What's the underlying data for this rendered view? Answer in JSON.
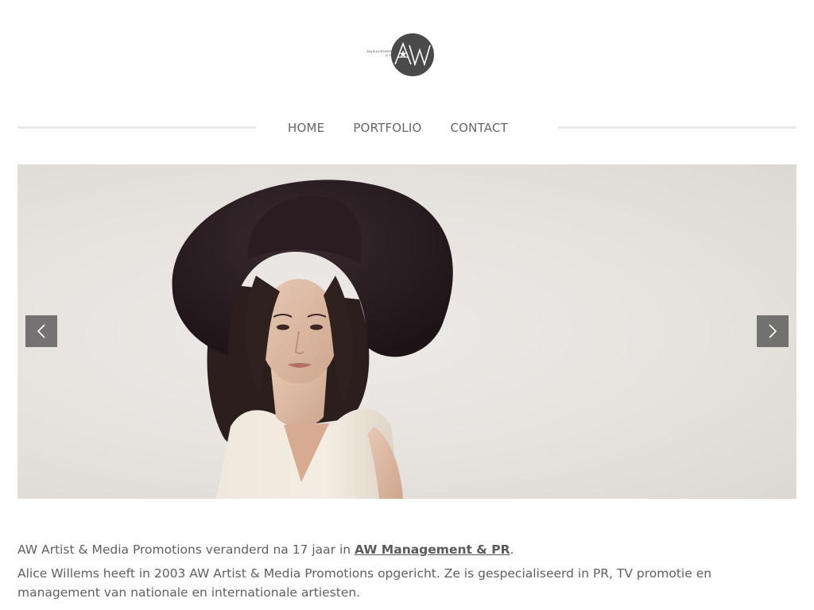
{
  "logo": {
    "text_line1": "MANAGEMENT",
    "text_line2": "& PR",
    "monogram": "AW",
    "circle_color": "#4a4a4a"
  },
  "nav": {
    "items": [
      {
        "label": "HOME"
      },
      {
        "label": "PORTFOLIO"
      },
      {
        "label": "CONTACT"
      }
    ]
  },
  "slider": {
    "prev_icon": "chevron-left-icon",
    "next_icon": "chevron-right-icon"
  },
  "content": {
    "p1_before": "AW Artist & Media Promotions veranderd na 17 jaar in ",
    "p1_link": "AW Management & PR",
    "p1_after": ".",
    "p2": "Alice Willems heeft in 2003 AW Artist & Media Promotions opgericht. Ze is gespecialiseerd in PR, TV promotie en management van nationale en internationale artiesten."
  },
  "colors": {
    "text": "#606060",
    "nav_text": "#666666",
    "divider": "#e9e9e9",
    "slider_button": "#464646"
  }
}
